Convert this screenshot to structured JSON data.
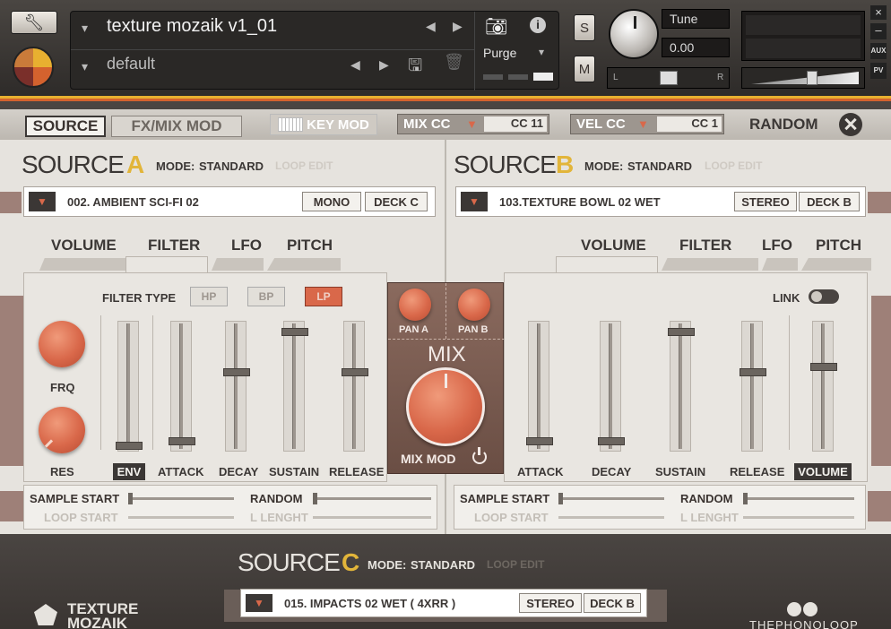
{
  "header": {
    "instrument_name": "texture mozaik v1_01",
    "snapshot": "default",
    "purge_label": "Purge",
    "solo_label": "S",
    "mute_label": "M",
    "tune_label": "Tune",
    "tune_value": "0.00",
    "pan_left": "L",
    "pan_right": "R",
    "aux_label": "AUX",
    "pv_label": "PV",
    "close_label": "×",
    "minimize_label": "–"
  },
  "tabs": {
    "source": "SOURCE",
    "fxmix": "FX/MIX MOD",
    "keymod": "KEY MOD",
    "mixcc": "MIX CC",
    "mixcc_value": "CC 11",
    "velcc": "VEL CC",
    "velcc_value": "CC 1",
    "random": "RANDOM"
  },
  "source_a": {
    "title": "SOURCE",
    "letter": "A",
    "mode_label": "MODE:",
    "mode_value": "STANDARD",
    "loop_edit": "LOOP EDIT",
    "sample": "002. AMBIENT SCI-FI 02",
    "channel": "MONO",
    "deck": "DECK C",
    "subtabs": [
      "VOLUME",
      "FILTER",
      "LFO",
      "PITCH"
    ],
    "filter_type_label": "FILTER TYPE",
    "filter_types": [
      "HP",
      "BP",
      "LP"
    ],
    "knob_frq": "FRQ",
    "knob_res": "RES",
    "env_label": "ENV",
    "faders": [
      {
        "label": "ATTACK",
        "level": 0.05
      },
      {
        "label": "DECAY",
        "level": 0.62
      },
      {
        "label": "SUSTAIN",
        "level": 0.95
      },
      {
        "label": "RELEASE",
        "level": 0.62
      }
    ],
    "sample_start": "SAMPLE START",
    "random": "RANDOM",
    "loop_start": "LOOP START",
    "l_lenght": "L LENGHT"
  },
  "mix": {
    "pan_a": "PAN A",
    "pan_b": "PAN B",
    "mix_label": "MIX",
    "mix_mod": "MIX MOD"
  },
  "source_b": {
    "title": "SOURCE",
    "letter": "B",
    "mode_label": "MODE:",
    "mode_value": "STANDARD",
    "loop_edit": "LOOP EDIT",
    "sample": "103.TEXTURE BOWL 02 WET",
    "channel": "STEREO",
    "deck": "DECK B",
    "subtabs": [
      "VOLUME",
      "FILTER",
      "LFO",
      "PITCH"
    ],
    "link_label": "LINK",
    "volume_label": "VOLUME",
    "faders": [
      {
        "label": "ATTACK",
        "level": 0.05
      },
      {
        "label": "DECAY",
        "level": 0.05
      },
      {
        "label": "SUSTAIN",
        "level": 0.95
      },
      {
        "label": "RELEASE",
        "level": 0.62
      },
      {
        "label": "VOLUME",
        "level": 0.66
      }
    ],
    "sample_start": "SAMPLE START",
    "random": "RANDOM",
    "loop_start": "LOOP START",
    "l_lenght": "L LENGHT"
  },
  "source_c": {
    "title": "SOURCE",
    "letter": "C",
    "mode_label": "MODE:",
    "mode_value": "STANDARD",
    "loop_edit": "LOOP EDIT",
    "sample": "015. IMPACTS 02 WET ( 4XRR )",
    "channel": "STEREO",
    "deck": "DECK B"
  },
  "footer": {
    "brand_line1": "TEXTURE",
    "brand_line2": "MOZAIK",
    "maker": "THEPHONOLOOP"
  },
  "colors": {
    "accent_orange": "#d9684a",
    "letter_yellow": "#e2b53a",
    "stripe_yellow": "#e8b030",
    "stripe_orange": "#d4622e"
  }
}
